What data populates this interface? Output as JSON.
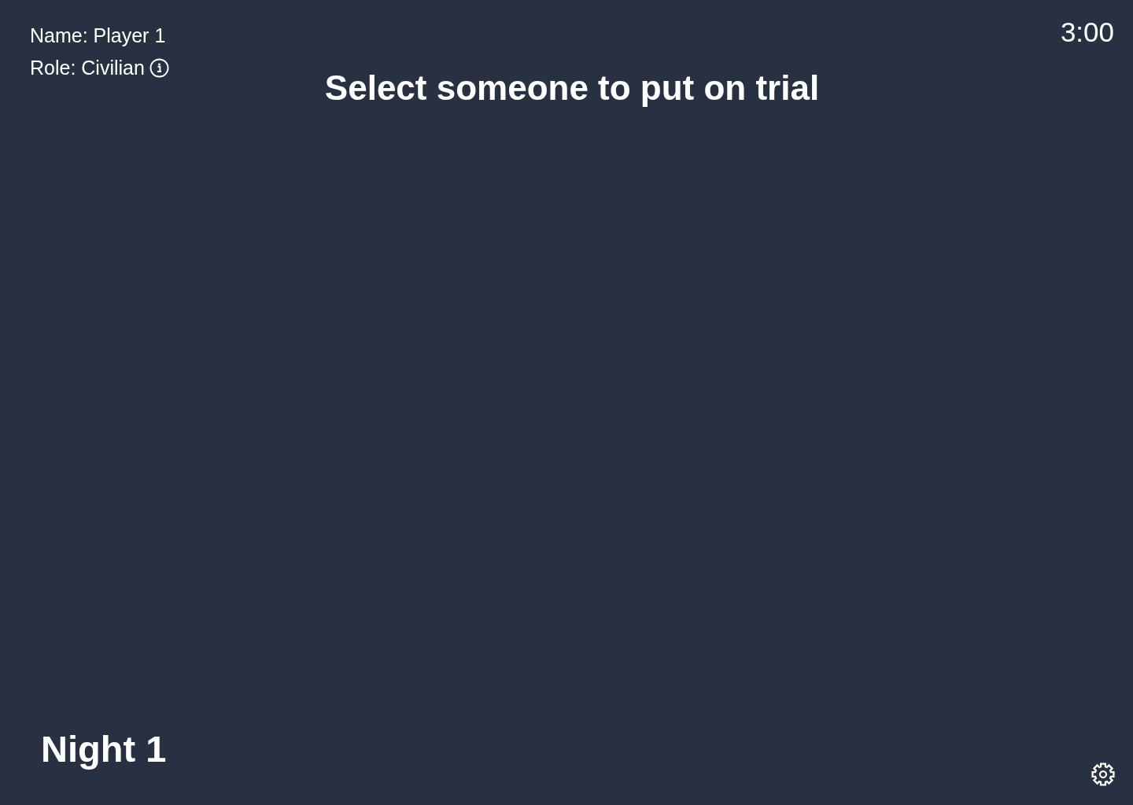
{
  "player_info": {
    "name": "Name: Player 1",
    "role": "Role: Civilian"
  },
  "timer": "3:00",
  "prompt": "Select someone to put on trial",
  "phase": "Night 1"
}
